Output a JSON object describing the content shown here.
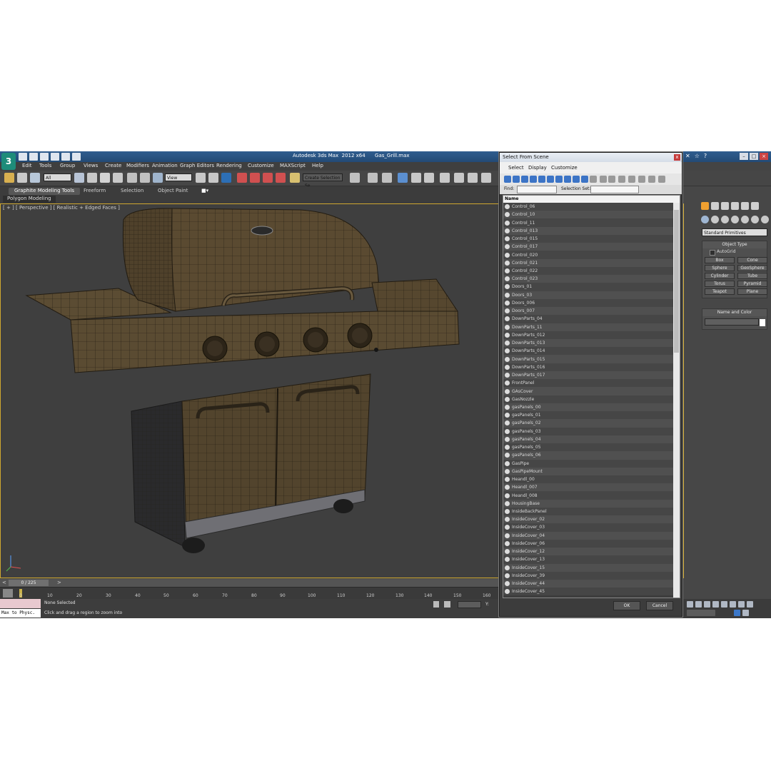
{
  "app": {
    "title": "Autodesk 3ds Max  2012 x64      Gas_Grill.max",
    "logo": "3"
  },
  "menu": [
    "Edit",
    "Tools",
    "Group",
    "Views",
    "Create",
    "Modifiers",
    "Animation",
    "Graph Editors",
    "Rendering",
    "Customize",
    "MAXScript",
    "Help"
  ],
  "toolbar": {
    "selection_filter": "All",
    "reference_coord": "View",
    "named_selection": "Create Selection Se"
  },
  "ribbon": {
    "tabs": [
      "Graphite Modeling Tools",
      "Freeform",
      "Selection",
      "Object Paint"
    ],
    "sub_label": "Polygon Modeling"
  },
  "viewport": {
    "label": "[ + ] [ Perspective ] [ Realistic + Edged Faces ]"
  },
  "timeline": {
    "frame_label": "0 / 225",
    "ticks": [
      "0",
      "10",
      "20",
      "30",
      "40",
      "50",
      "60",
      "70",
      "80",
      "90",
      "100",
      "110",
      "120",
      "130",
      "140",
      "150",
      "160"
    ]
  },
  "status": {
    "maxscript": "Max to Physc.",
    "selection": "None Selected",
    "prompt": "Click and drag a region to zoom into"
  },
  "command_panel": {
    "dropdown": "Standard Primitives",
    "object_type_title": "Object Type",
    "autogrid": "AutoGrid",
    "buttons": [
      "Box",
      "Cone",
      "Sphere",
      "GeoSphere",
      "Cylinder",
      "Tube",
      "Torus",
      "Pyramid",
      "Teapot",
      "Plane"
    ],
    "name_color_title": "Name and Color"
  },
  "dialog": {
    "title": "Select From Scene",
    "close": "x",
    "menu": [
      "Select",
      "Display",
      "Customize"
    ],
    "find_label": "Find:",
    "selection_set_label": "Selection Set:",
    "column_header": "Name",
    "items": [
      "Control_06",
      "Control_10",
      "Control_11",
      "Control_013",
      "Control_015",
      "Control_017",
      "Control_020",
      "Control_021",
      "Control_022",
      "Control_023",
      "Doors_01",
      "Doors_03",
      "Doors_006",
      "Doors_007",
      "DownParts_04",
      "DownParts_11",
      "DownParts_012",
      "DownParts_013",
      "DownParts_014",
      "DownParts_015",
      "DownParts_016",
      "DownParts_017",
      "FrontPanel",
      "GAsCover",
      "GasNozzle",
      "gasPanels_00",
      "gasPanels_01",
      "gasPanels_02",
      "gasPanels_03",
      "gasPanels_04",
      "gasPanels_05",
      "gasPanels_06",
      "GasPipe",
      "GasPipeMount",
      "Heandl_00",
      "Heandl_007",
      "Heandl_008",
      "HousingBase",
      "InsideBackPanel",
      "InsideCover_02",
      "InsideCover_03",
      "InsideCover_04",
      "InsideCover_06",
      "InsideCover_12",
      "InsideCover_13",
      "InsideCover_15",
      "InsideCover_39",
      "InsideCover_44",
      "InsideCover_45"
    ],
    "ok": "OK",
    "cancel": "Cancel"
  }
}
